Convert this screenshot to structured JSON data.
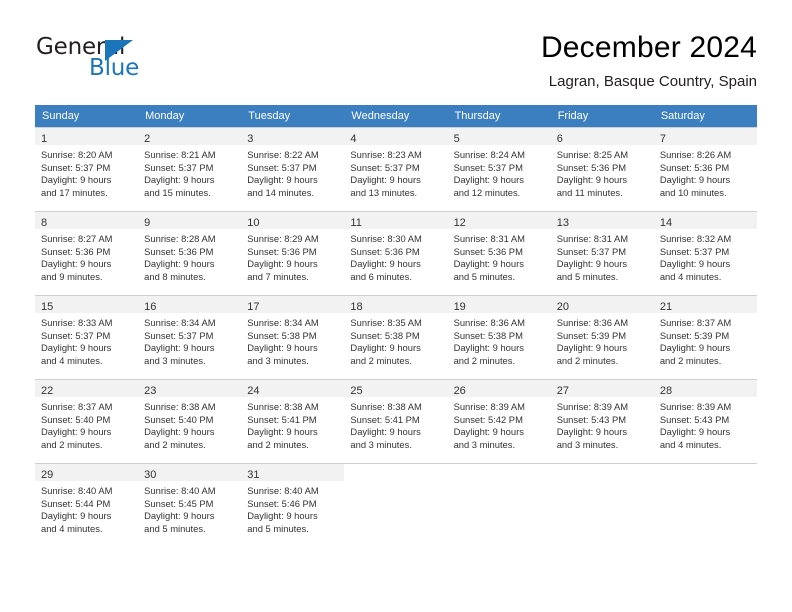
{
  "brand": {
    "name_part1": "General",
    "name_part2": "Blue",
    "accent_color": "#1b75bb"
  },
  "header": {
    "title": "December 2024",
    "subtitle": "Lagran, Basque Country, Spain"
  },
  "calendar": {
    "header_bg": "#3c7fc1",
    "weekday_headers": [
      "Sunday",
      "Monday",
      "Tuesday",
      "Wednesday",
      "Thursday",
      "Friday",
      "Saturday"
    ],
    "weeks": [
      [
        {
          "day": "1",
          "lines": [
            "Sunrise: 8:20 AM",
            "Sunset: 5:37 PM",
            "Daylight: 9 hours",
            "and 17 minutes."
          ]
        },
        {
          "day": "2",
          "lines": [
            "Sunrise: 8:21 AM",
            "Sunset: 5:37 PM",
            "Daylight: 9 hours",
            "and 15 minutes."
          ]
        },
        {
          "day": "3",
          "lines": [
            "Sunrise: 8:22 AM",
            "Sunset: 5:37 PM",
            "Daylight: 9 hours",
            "and 14 minutes."
          ]
        },
        {
          "day": "4",
          "lines": [
            "Sunrise: 8:23 AM",
            "Sunset: 5:37 PM",
            "Daylight: 9 hours",
            "and 13 minutes."
          ]
        },
        {
          "day": "5",
          "lines": [
            "Sunrise: 8:24 AM",
            "Sunset: 5:37 PM",
            "Daylight: 9 hours",
            "and 12 minutes."
          ]
        },
        {
          "day": "6",
          "lines": [
            "Sunrise: 8:25 AM",
            "Sunset: 5:36 PM",
            "Daylight: 9 hours",
            "and 11 minutes."
          ]
        },
        {
          "day": "7",
          "lines": [
            "Sunrise: 8:26 AM",
            "Sunset: 5:36 PM",
            "Daylight: 9 hours",
            "and 10 minutes."
          ]
        }
      ],
      [
        {
          "day": "8",
          "lines": [
            "Sunrise: 8:27 AM",
            "Sunset: 5:36 PM",
            "Daylight: 9 hours",
            "and 9 minutes."
          ]
        },
        {
          "day": "9",
          "lines": [
            "Sunrise: 8:28 AM",
            "Sunset: 5:36 PM",
            "Daylight: 9 hours",
            "and 8 minutes."
          ]
        },
        {
          "day": "10",
          "lines": [
            "Sunrise: 8:29 AM",
            "Sunset: 5:36 PM",
            "Daylight: 9 hours",
            "and 7 minutes."
          ]
        },
        {
          "day": "11",
          "lines": [
            "Sunrise: 8:30 AM",
            "Sunset: 5:36 PM",
            "Daylight: 9 hours",
            "and 6 minutes."
          ]
        },
        {
          "day": "12",
          "lines": [
            "Sunrise: 8:31 AM",
            "Sunset: 5:36 PM",
            "Daylight: 9 hours",
            "and 5 minutes."
          ]
        },
        {
          "day": "13",
          "lines": [
            "Sunrise: 8:31 AM",
            "Sunset: 5:37 PM",
            "Daylight: 9 hours",
            "and 5 minutes."
          ]
        },
        {
          "day": "14",
          "lines": [
            "Sunrise: 8:32 AM",
            "Sunset: 5:37 PM",
            "Daylight: 9 hours",
            "and 4 minutes."
          ]
        }
      ],
      [
        {
          "day": "15",
          "lines": [
            "Sunrise: 8:33 AM",
            "Sunset: 5:37 PM",
            "Daylight: 9 hours",
            "and 4 minutes."
          ]
        },
        {
          "day": "16",
          "lines": [
            "Sunrise: 8:34 AM",
            "Sunset: 5:37 PM",
            "Daylight: 9 hours",
            "and 3 minutes."
          ]
        },
        {
          "day": "17",
          "lines": [
            "Sunrise: 8:34 AM",
            "Sunset: 5:38 PM",
            "Daylight: 9 hours",
            "and 3 minutes."
          ]
        },
        {
          "day": "18",
          "lines": [
            "Sunrise: 8:35 AM",
            "Sunset: 5:38 PM",
            "Daylight: 9 hours",
            "and 2 minutes."
          ]
        },
        {
          "day": "19",
          "lines": [
            "Sunrise: 8:36 AM",
            "Sunset: 5:38 PM",
            "Daylight: 9 hours",
            "and 2 minutes."
          ]
        },
        {
          "day": "20",
          "lines": [
            "Sunrise: 8:36 AM",
            "Sunset: 5:39 PM",
            "Daylight: 9 hours",
            "and 2 minutes."
          ]
        },
        {
          "day": "21",
          "lines": [
            "Sunrise: 8:37 AM",
            "Sunset: 5:39 PM",
            "Daylight: 9 hours",
            "and 2 minutes."
          ]
        }
      ],
      [
        {
          "day": "22",
          "lines": [
            "Sunrise: 8:37 AM",
            "Sunset: 5:40 PM",
            "Daylight: 9 hours",
            "and 2 minutes."
          ]
        },
        {
          "day": "23",
          "lines": [
            "Sunrise: 8:38 AM",
            "Sunset: 5:40 PM",
            "Daylight: 9 hours",
            "and 2 minutes."
          ]
        },
        {
          "day": "24",
          "lines": [
            "Sunrise: 8:38 AM",
            "Sunset: 5:41 PM",
            "Daylight: 9 hours",
            "and 2 minutes."
          ]
        },
        {
          "day": "25",
          "lines": [
            "Sunrise: 8:38 AM",
            "Sunset: 5:41 PM",
            "Daylight: 9 hours",
            "and 3 minutes."
          ]
        },
        {
          "day": "26",
          "lines": [
            "Sunrise: 8:39 AM",
            "Sunset: 5:42 PM",
            "Daylight: 9 hours",
            "and 3 minutes."
          ]
        },
        {
          "day": "27",
          "lines": [
            "Sunrise: 8:39 AM",
            "Sunset: 5:43 PM",
            "Daylight: 9 hours",
            "and 3 minutes."
          ]
        },
        {
          "day": "28",
          "lines": [
            "Sunrise: 8:39 AM",
            "Sunset: 5:43 PM",
            "Daylight: 9 hours",
            "and 4 minutes."
          ]
        }
      ],
      [
        {
          "day": "29",
          "lines": [
            "Sunrise: 8:40 AM",
            "Sunset: 5:44 PM",
            "Daylight: 9 hours",
            "and 4 minutes."
          ]
        },
        {
          "day": "30",
          "lines": [
            "Sunrise: 8:40 AM",
            "Sunset: 5:45 PM",
            "Daylight: 9 hours",
            "and 5 minutes."
          ]
        },
        {
          "day": "31",
          "lines": [
            "Sunrise: 8:40 AM",
            "Sunset: 5:46 PM",
            "Daylight: 9 hours",
            "and 5 minutes."
          ]
        },
        null,
        null,
        null,
        null
      ]
    ]
  }
}
